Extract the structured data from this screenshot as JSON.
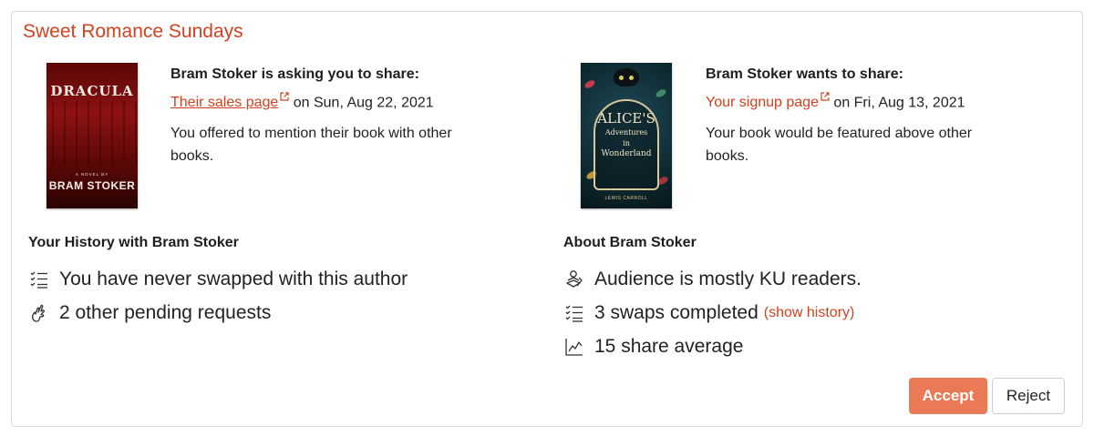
{
  "card": {
    "title": "Sweet Romance Sundays"
  },
  "left_book": {
    "cover_title": "DRACULA",
    "cover_subtitle": "A NOVEL BY",
    "cover_author": "BRAM STOKER",
    "heading": "Bram Stoker is asking you to share:",
    "link_text": "Their sales page",
    "date_text": " on Sun, Aug 22, 2021",
    "description": "You offered to mention their book with other books."
  },
  "right_book": {
    "cover_title_1": "ALICE'S",
    "cover_title_2": "Adventures",
    "cover_title_3": "in",
    "cover_title_4": "Wonderland",
    "cover_author": "LEWIS CARROLL",
    "heading": "Bram Stoker wants to share:",
    "link_text": "Your signup page",
    "date_text": " on Fri, Aug 13, 2021",
    "description": "Your book would be featured above other books."
  },
  "history": {
    "title": "Your History with Bram Stoker",
    "items": [
      {
        "icon": "checklist-icon",
        "text": "You have never swapped with this author"
      },
      {
        "icon": "crossed-fingers-icon",
        "text": "2 other pending requests"
      }
    ]
  },
  "about": {
    "title": "About Bram Stoker",
    "items": [
      {
        "icon": "reader-icon",
        "text": "Audience is mostly KU readers."
      },
      {
        "icon": "checklist-icon",
        "text": "3 swaps completed",
        "link": "(show history)"
      },
      {
        "icon": "line-chart-icon",
        "text": "15 share average"
      }
    ]
  },
  "actions": {
    "accept_label": "Accept",
    "reject_label": "Reject"
  },
  "colors": {
    "accent": "#d4411e",
    "accept_bg": "#ea7a56"
  }
}
